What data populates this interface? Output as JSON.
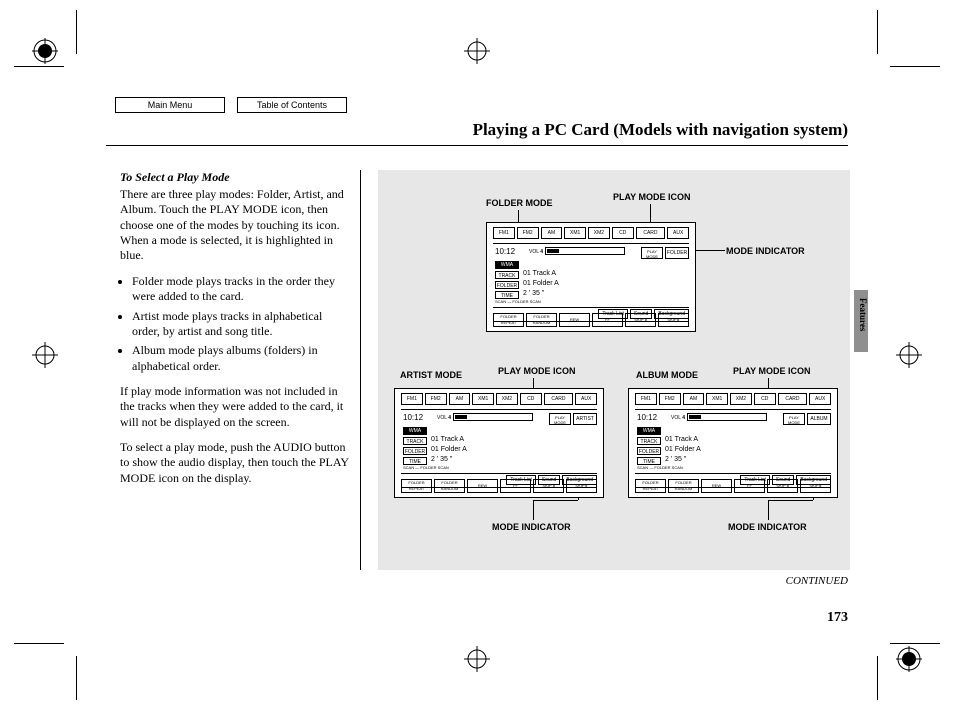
{
  "nav": {
    "main_menu": "Main Menu",
    "toc": "Table of Contents"
  },
  "title": "Playing a PC Card (Models with navigation system)",
  "sidetab": "Features",
  "text": {
    "heading": "To Select a Play Mode",
    "p1": "There are three play modes: Folder, Artist, and Album. Touch the PLAY MODE icon, then choose one of the modes by touching its icon. When a mode is selected, it is highlighted in blue.",
    "b1": "Folder mode plays tracks in the order they were added to the card.",
    "b2": "Artist mode plays tracks in alphabetical order, by artist and song title.",
    "b3": "Album mode plays albums (folders) in alphabetical order.",
    "p2": "If play mode information was not included in the tracks when they were added to the card, it will not be displayed on the screen.",
    "p3": "To select a play mode, push the AUDIO button to show the audio display, then touch the PLAY MODE icon on the display."
  },
  "callouts": {
    "folder_mode": "FOLDER MODE",
    "artist_mode": "ARTIST MODE",
    "album_mode": "ALBUM MODE",
    "play_mode_icon": "PLAY MODE ICON",
    "mode_indicator": "MODE INDICATOR"
  },
  "device": {
    "sources": [
      "FM1",
      "FM2",
      "AM",
      "XM1",
      "XM2",
      "CD",
      "CARD",
      "AUX"
    ],
    "clock": "10:12",
    "vol_label": "VOL",
    "vol_value": "4",
    "pm_label": "PLAY MODE",
    "modes": {
      "folder": "FOLDER",
      "artist": "ARTIST",
      "album": "ALBUM"
    },
    "badge_wma": "WMA",
    "tag_track": "TRACK",
    "tag_folder": "FOLDER",
    "tag_time": "TIME",
    "track": "01 Track A",
    "folder": "01 Folder A",
    "time": "2 ' 35 \"",
    "scan_label": "SCAN",
    "folder_scan": "FOLDER SCAN",
    "row_modes": [
      "Track List",
      "Sound",
      "Background"
    ],
    "bottom": [
      "FOLDER REPEAT",
      "FOLDER RANDOM",
      "REW",
      "FF",
      "SKIP ◂",
      "SKIP ▸"
    ]
  },
  "continued": "CONTINUED",
  "page_number": "173"
}
